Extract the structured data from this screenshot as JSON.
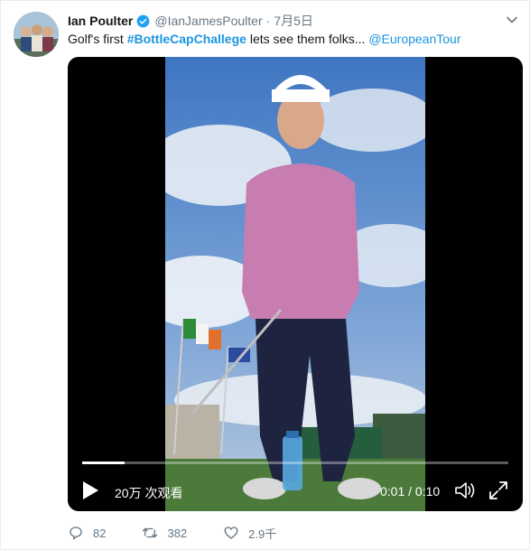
{
  "tweet": {
    "author_name": "Ian Poulter",
    "handle": "@IanJamesPoulter",
    "separator": "·",
    "date": "7月5日",
    "text_prefix": "Golf's first ",
    "hashtag": "#BottleCapChallege",
    "text_middle": " lets see them folks... ",
    "mention": "@EuropeanTour"
  },
  "video": {
    "views": "20万 次观看",
    "time": "0:01 / 0:10",
    "progress_fraction": 0.1
  },
  "actions": {
    "replies": "82",
    "retweets": "382",
    "likes": "2.9千"
  },
  "icons": {
    "verified": "verified-badge-icon",
    "caret": "chevron-down-icon",
    "play": "play-icon",
    "volume": "volume-icon",
    "fullscreen": "fullscreen-icon",
    "reply": "reply-icon",
    "retweet": "retweet-icon",
    "like": "heart-icon"
  },
  "colors": {
    "link": "#1b95e0",
    "secondary_text": "#657786",
    "video_bg": "#000000"
  }
}
